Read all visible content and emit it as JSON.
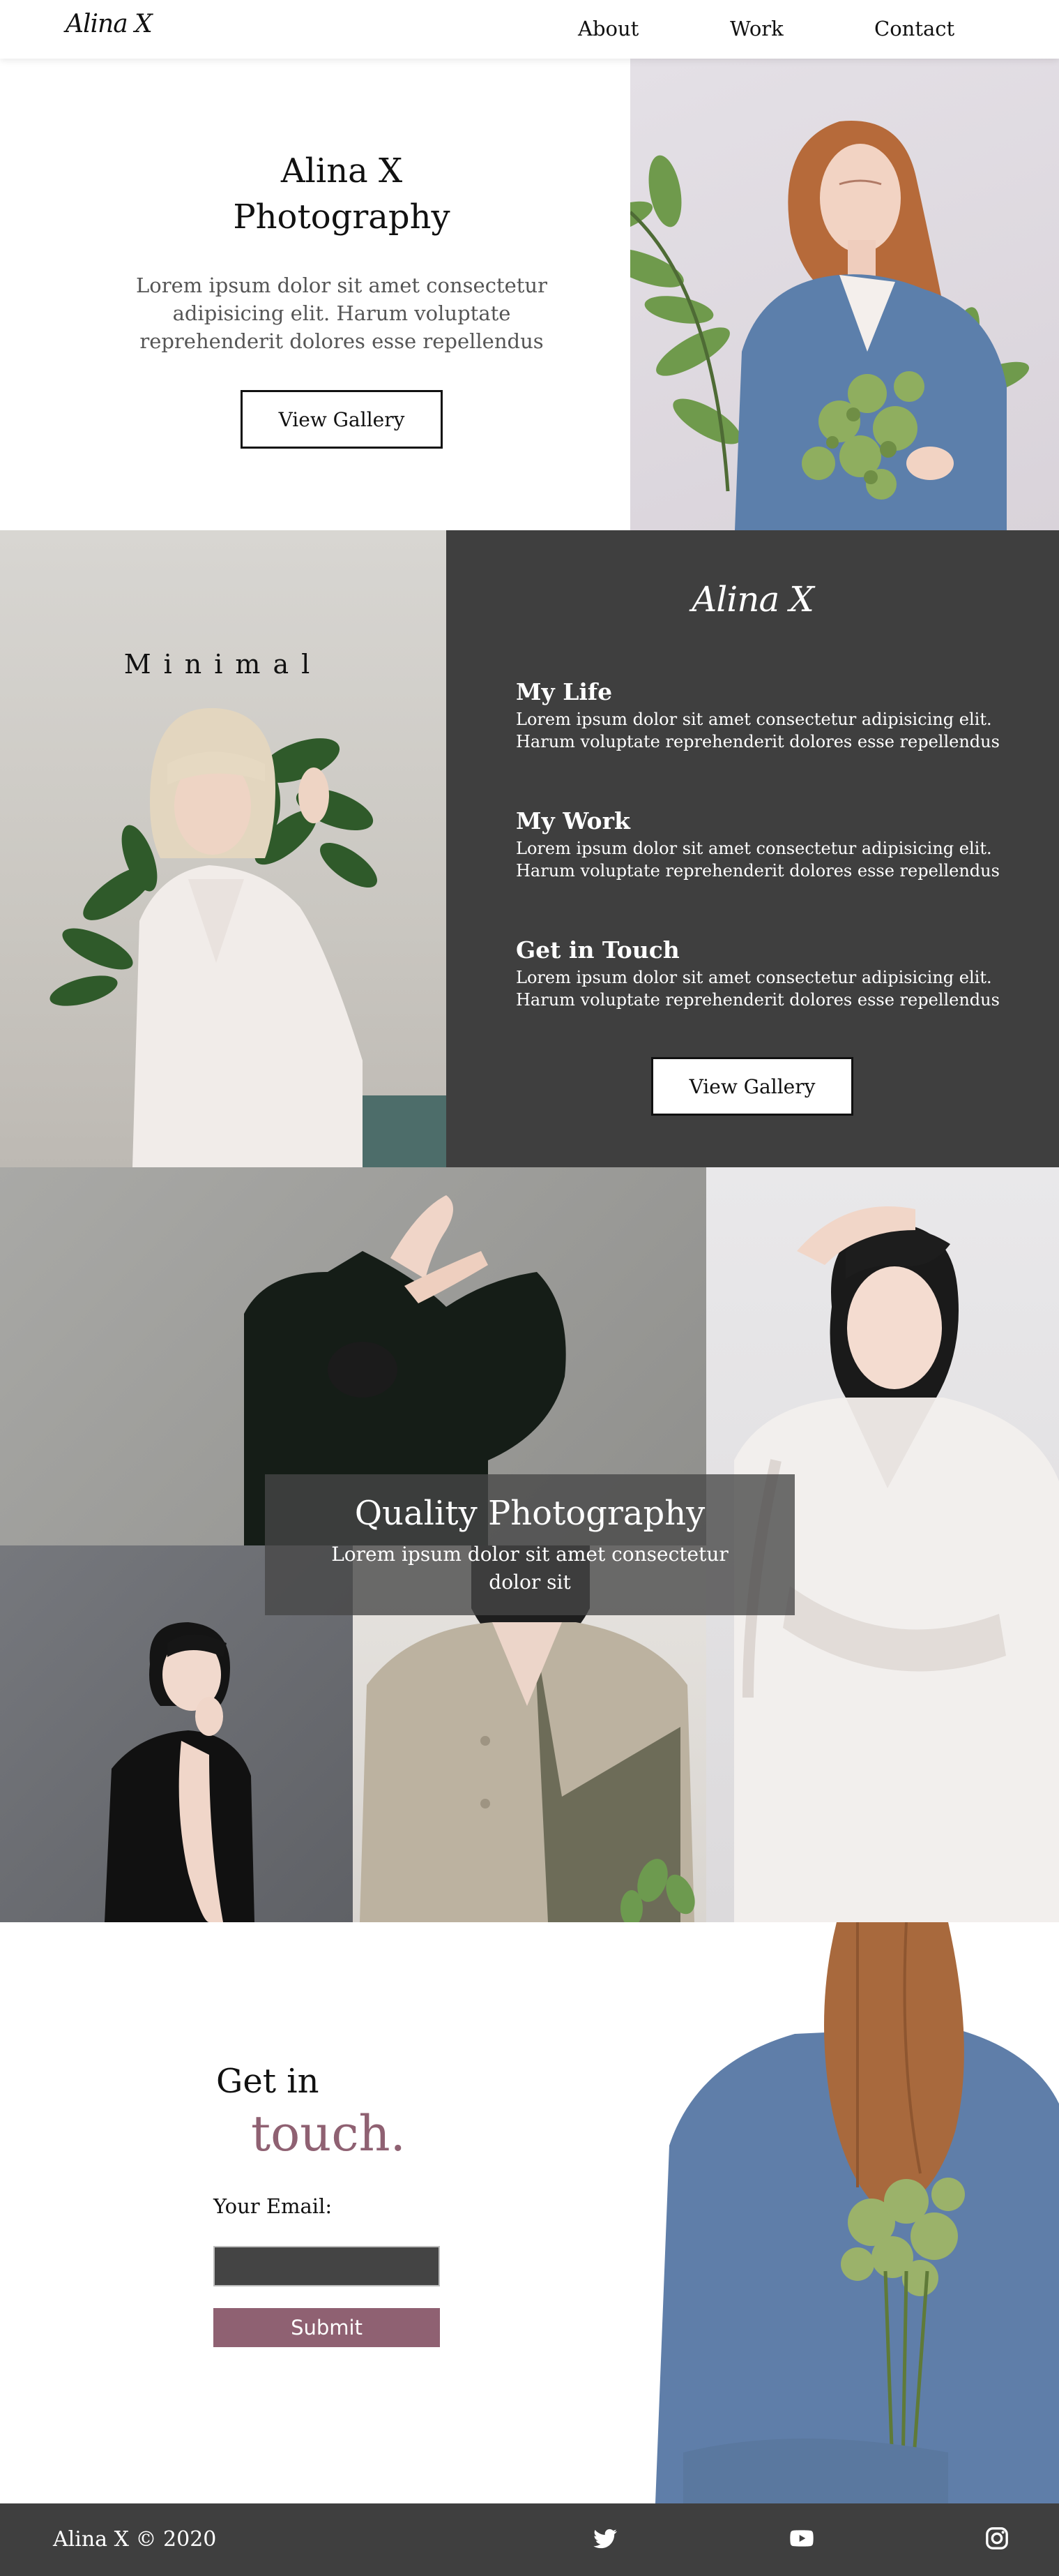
{
  "nav": {
    "logo": "Alina X",
    "links": [
      "About",
      "Work",
      "Contact"
    ]
  },
  "hero": {
    "title": "Alina X Photography",
    "text": "Lorem ipsum dolor sit amet consectetur adipisicing elit. Harum voluptate reprehenderit dolores esse repellendus",
    "button": "View Gallery"
  },
  "about": {
    "photo_label": "Minimal",
    "panel_logo": "Alina X",
    "items": [
      {
        "title": "My Life",
        "text": "Lorem ipsum dolor sit amet consectetur adipisicing elit. Harum voluptate reprehenderit dolores esse repellendus"
      },
      {
        "title": "My Work",
        "text": "Lorem ipsum dolor sit amet consectetur adipisicing elit. Harum voluptate reprehenderit dolores esse repellendus"
      },
      {
        "title": "Get in Touch",
        "text": "Lorem ipsum dolor sit amet consectetur adipisicing elit. Harum voluptate reprehenderit dolores esse repellendus"
      }
    ],
    "button": "View Gallery"
  },
  "gallery": {
    "overlay_title": "Quality Photography",
    "overlay_text": "Lorem ipsum dolor sit amet consectetur dolor sit"
  },
  "contact": {
    "heading_line1": "Get in",
    "heading_line2": "touch.",
    "email_label": "Your Email:",
    "email_value": "",
    "submit": "Submit"
  },
  "footer": {
    "copyright": "Alina X © 2020",
    "social": [
      "twitter-icon",
      "youtube-icon",
      "instagram-icon"
    ]
  },
  "colors": {
    "accent": "#8f6172",
    "dark_panel": "#3f3f3f",
    "footer": "#3f3f3f"
  }
}
